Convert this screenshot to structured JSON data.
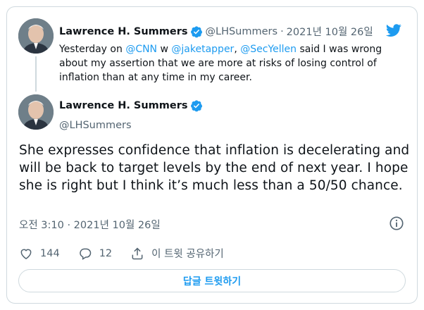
{
  "quoted": {
    "author_name": "Lawrence H. Summers",
    "handle": "@LHSummers",
    "separator": "·",
    "date": "2021년 10월 26일",
    "text_parts": {
      "t1": "Yesterday on ",
      "m1": "@CNN",
      "t2": "  w ",
      "m2": "@jaketapper",
      "t3": ", ",
      "m3": "@SecYellen",
      "t4": " said I was wrong about my assertion that we are more at risks of losing control of inflation than at any time in my career."
    }
  },
  "main": {
    "author_name": "Lawrence H. Summers",
    "handle": "@LHSummers",
    "text": "She expresses confidence that inflation is decelerating and will be back to target levels by the end of next year.  I hope she is right but I think it’s much less than a 50/50 chance.",
    "timestamp": "오전 3:10 · 2021년 10월 26일"
  },
  "actions": {
    "likes": "144",
    "replies": "12",
    "share_label": "이 트윗 공유하기"
  },
  "reply_button_label": "답글 트윗하기",
  "colors": {
    "accent": "#1d9bf0",
    "text": "#0f1419",
    "secondary": "#536471",
    "border": "#cfd9de"
  },
  "icons": [
    "twitter-bird-icon",
    "verified-badge-icon",
    "info-icon",
    "heart-icon",
    "reply-bubble-icon",
    "share-icon"
  ]
}
